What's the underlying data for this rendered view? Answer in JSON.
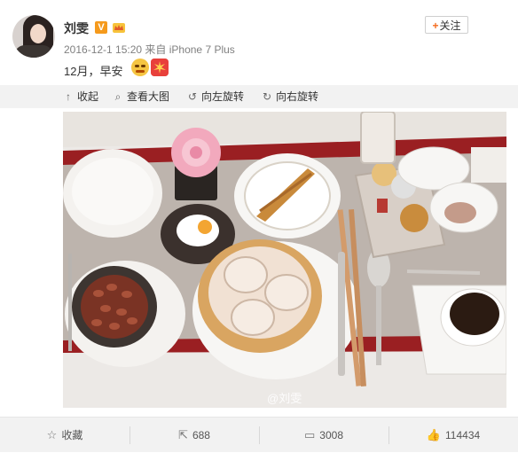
{
  "author": {
    "name": "刘雯",
    "verified_badge": "V",
    "meta": "2016-12-1 15:20 来自 iPhone 7 Plus",
    "follow_label": "关注",
    "follow_plus": "+"
  },
  "post": {
    "text": "12月，早安",
    "watermark": "@刘雯"
  },
  "toolbar": {
    "collapse": "收起",
    "view_large": "查看大图",
    "rotate_left": "向左旋转",
    "rotate_right": "向右旋转"
  },
  "footer": {
    "favorite": "收藏",
    "repost_count": "688",
    "comment_count": "3008",
    "like_count": "114434"
  },
  "colors": {
    "accent_orange": "#f46c1f",
    "verified_badge": "#f59a1c",
    "toolbar_bg": "#f2f2f2"
  },
  "icons": {
    "collapse": "arrow-up-icon",
    "view_large": "magnifier-icon",
    "rotate_left": "rotate-left-icon",
    "rotate_right": "rotate-right-icon",
    "favorite": "star-icon",
    "repost": "share-icon",
    "comment": "comment-icon",
    "like": "thumbs-up-icon"
  }
}
